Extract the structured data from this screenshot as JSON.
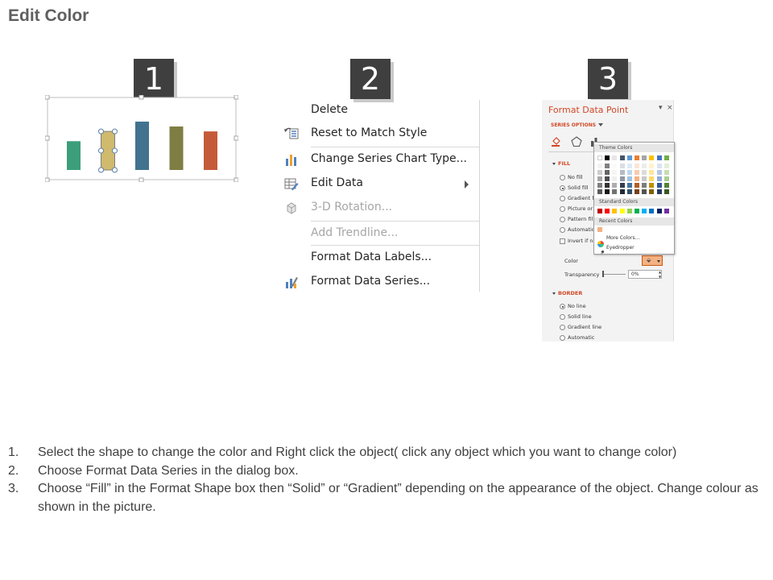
{
  "page": {
    "title": "Edit Color"
  },
  "badges": [
    "1",
    "2",
    "3"
  ],
  "chart": {
    "bars": [
      {
        "color": "#3c9e7a",
        "height": 0.47,
        "selected": false
      },
      {
        "color": "#cfba6e",
        "height": 0.63,
        "selected": true
      },
      {
        "color": "#41738f",
        "height": 0.79,
        "selected": false
      },
      {
        "color": "#7e7d43",
        "height": 0.71,
        "selected": false
      },
      {
        "color": "#c55a3a",
        "height": 0.63,
        "selected": false
      }
    ]
  },
  "context_menu": {
    "items": [
      {
        "label": "Delete",
        "icon": "none",
        "disabled": false
      },
      {
        "label": "Reset to Match Style",
        "icon": "reset-style-icon",
        "disabled": false
      },
      {
        "label": "Change Series Chart Type...",
        "icon": "bar-chart-icon",
        "disabled": false
      },
      {
        "label": "Edit Data",
        "icon": "edit-data-icon",
        "disabled": false,
        "submenu": true
      },
      {
        "label": "3-D Rotation...",
        "icon": "cube-icon",
        "disabled": true
      },
      {
        "label": "Add Trendline...",
        "icon": "none",
        "disabled": true
      },
      {
        "label": "Format Data Labels...",
        "icon": "none",
        "disabled": false
      },
      {
        "label": "Format Data Series...",
        "icon": "format-series-icon",
        "disabled": false
      }
    ]
  },
  "format_pane": {
    "title": "Format Data Point",
    "pin": "▾",
    "close": "×",
    "series_options": "SERIES OPTIONS",
    "fill_header": "FILL",
    "fill_options": [
      "No fill",
      "Solid fill",
      "Gradient fill",
      "Picture or",
      "Pattern fill",
      "Automatic"
    ],
    "fill_selected": "Solid fill",
    "invert_label": "Invert if ne",
    "color_label": "Color",
    "transparency_label": "Transparency",
    "transparency_value": "0%",
    "border_header": "BORDER",
    "border_options": [
      "No line",
      "Solid line",
      "Gradient line",
      "Automatic"
    ],
    "border_selected": "No line"
  },
  "color_popup": {
    "theme_header": "Theme Colors",
    "standard_header": "Standard Colors",
    "recent_header": "Recent Colors",
    "more_colors": "More Colors...",
    "eyedropper": "Eyedropper",
    "theme_top": [
      "#ffffff",
      "#000000",
      "#e7e6e6",
      "#44546a",
      "#5b9bd5",
      "#ed7d31",
      "#a5a5a5",
      "#ffc000",
      "#4472c4",
      "#70ad47"
    ],
    "standard": [
      "#c00000",
      "#ff0000",
      "#ffc000",
      "#ffff00",
      "#92d050",
      "#00b050",
      "#00b0f0",
      "#0070c0",
      "#002060",
      "#7030a0"
    ],
    "recent": [
      "#f4b183"
    ]
  },
  "instructions": [
    {
      "num": "1.",
      "text": "Select the shape to change the color and Right click the object( click any object which you want to change color)"
    },
    {
      "num": "2.",
      "text": "Choose Format Data Series in the dialog box."
    },
    {
      "num": "3.",
      "text": "Choose “Fill” in the Format Shape box then “Solid” or “Gradient” depending on the appearance of the object. Change colour as shown in the picture."
    }
  ]
}
